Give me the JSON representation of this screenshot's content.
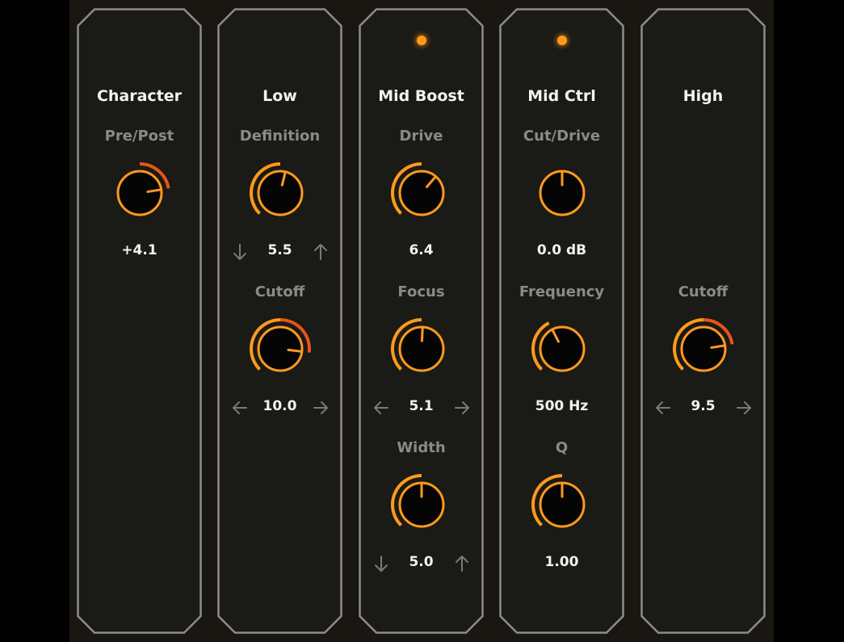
{
  "colors": {
    "accent": "#ff9a1c",
    "accent_deep": "#e8541a",
    "panel_bg": "#1a1a16",
    "panel_border": "#8c8c8c",
    "param_label": "#8a8a8a",
    "text": "#f2f2f2"
  },
  "panels": [
    {
      "title": "Character",
      "led_on": false,
      "controls": [
        {
          "label": "Pre/Post",
          "value": "+4.1",
          "level": 0.8,
          "arcs": "right",
          "arrows": "none"
        }
      ]
    },
    {
      "title": "Low",
      "led_on": false,
      "controls": [
        {
          "label": "Definition",
          "value": "5.5",
          "level": 0.55,
          "arcs": "left",
          "arrows": "down-up"
        },
        {
          "label": "Cutoff",
          "value": "10.0",
          "level": 0.86,
          "arcs": "full",
          "arrows": "left-right"
        }
      ]
    },
    {
      "title": "Mid Boost",
      "led_on": true,
      "controls": [
        {
          "label": "Drive",
          "value": "6.4",
          "level": 0.65,
          "arcs": "left",
          "arrows": "none"
        },
        {
          "label": "Focus",
          "value": "5.1",
          "level": 0.51,
          "arcs": "left",
          "arrows": "left-right"
        },
        {
          "label": "Width",
          "value": "5.0",
          "level": 0.5,
          "arcs": "left",
          "arrows": "down-up"
        }
      ]
    },
    {
      "title": "Mid Ctrl",
      "led_on": true,
      "controls": [
        {
          "label": "Cut/Drive",
          "value": "0.0 dB",
          "level": 0.5,
          "arcs": "none",
          "arrows": "none"
        },
        {
          "label": "Frequency",
          "value": "500 Hz",
          "level": 0.4,
          "arcs": "left",
          "arrows": "none"
        },
        {
          "label": "Q",
          "value": "1.00",
          "level": 0.5,
          "arcs": "left",
          "arrows": "none"
        }
      ]
    },
    {
      "title": "High",
      "led_on": false,
      "controls": [
        {
          "label": "",
          "value": "",
          "level": null,
          "arcs": "none",
          "arrows": "none"
        },
        {
          "label": "Cutoff",
          "value": "9.5",
          "level": 0.8,
          "arcs": "full",
          "arrows": "left-right"
        }
      ]
    }
  ]
}
